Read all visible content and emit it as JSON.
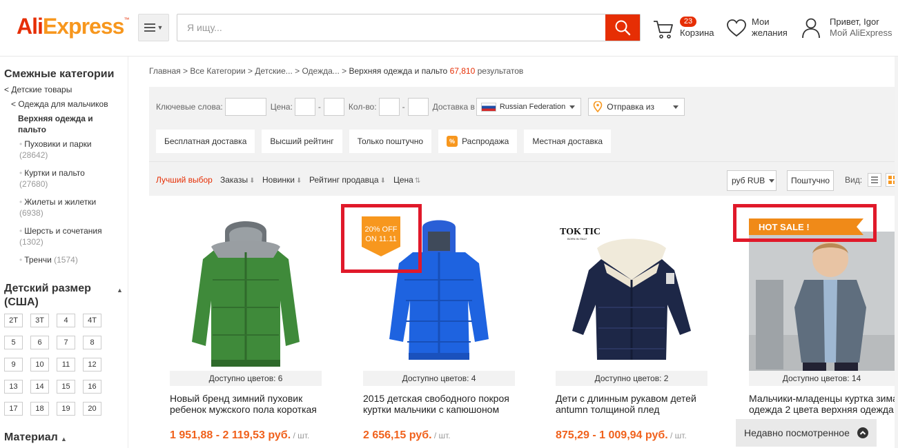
{
  "header": {
    "logo_part1": "Ali",
    "logo_part2": "Express",
    "logo_tm": "™",
    "search_placeholder": "Я ищу...",
    "cart_count": "23",
    "cart_label": "Корзина",
    "wishlist_line1": "Мои",
    "wishlist_line2": "желания",
    "account_line1": "Привет, Igor",
    "account_line2": "Мой AliExpress"
  },
  "sidebar": {
    "related_heading": "Смежные категории",
    "cat_parent": "< Детские товары",
    "cat_sub": "< Одежда для мальчиков",
    "cat_current": "Верхняя одежда и пальто",
    "subcats": [
      {
        "label": "Пуховики и парки",
        "count": "(28642)"
      },
      {
        "label": "Куртки и пальто",
        "count": "(27680)"
      },
      {
        "label": "Жилеты и жилетки",
        "count": "(6938)"
      },
      {
        "label": "Шерсть и сочетания",
        "count": "(1302)"
      },
      {
        "label": "Тренчи",
        "count": "(1574)"
      }
    ],
    "size_heading": "Детский размер (США)",
    "sizes": [
      "2T",
      "3T",
      "4",
      "4T",
      "5",
      "6",
      "7",
      "8",
      "9",
      "10",
      "11",
      "12",
      "13",
      "14",
      "15",
      "16",
      "17",
      "18",
      "19",
      "20"
    ],
    "material_heading": "Материал"
  },
  "breadcrumb": {
    "items": [
      "Главная",
      "Все Категории",
      "Детские...",
      "Одежда..."
    ],
    "current": "Верхняя одежда и пальто",
    "result_count": "67,810",
    "result_label": "результатов"
  },
  "filters": {
    "keywords_label": "Ключевые слова:",
    "price_label": "Цена:",
    "qty_label": "Кол-во:",
    "dash": "-",
    "ship_to_label": "Доставка в",
    "ship_to_value": "Russian Federation",
    "ship_from_label": "Отправка из",
    "buttons": [
      "Бесплатная доставка",
      "Высший рейтинг",
      "Только поштучно",
      "Распродажа",
      "Местная доставка"
    ],
    "sale_icon_text": "%"
  },
  "sortbar": {
    "best": "Лучший выбор",
    "orders": "Заказы",
    "newest": "Новинки",
    "seller_rating": "Рейтинг продавца",
    "price": "Цена",
    "currency": "руб RUB",
    "per_piece": "Поштучно",
    "view_label": "Вид:"
  },
  "products": [
    {
      "colors": "Доступно цветов: 6",
      "title1": "Новый бренд зимний пуховик",
      "title2": "ребенок мужского пола короткая",
      "price": "1 951,88 - 2 119,53 руб.",
      "unit": " / шт."
    },
    {
      "colors": "Доступно цветов: 4",
      "title1": "2015 детская свободного покроя",
      "title2": "куртки мальчики с капюшоном",
      "price": "2 656,15 руб.",
      "unit": " / шт.",
      "badge1": "20% OFF",
      "badge2": "ON 11.11"
    },
    {
      "colors": "Доступно цветов: 2",
      "title1": "Дети с длинным рукавом детей",
      "title2": "antumn толщиной плед",
      "price": "875,29 - 1 009,94 руб.",
      "unit": " / шт.",
      "brand1": "TOK TIC",
      "brand2": "BORN IN ITALY"
    },
    {
      "colors": "Доступно цветов: 14",
      "title1": "Мальчики-младенцы куртка зима",
      "title2": "одежда 2 цвета верхняя одежда",
      "price": "",
      "unit": "",
      "banner": "HOT SALE !"
    }
  ],
  "recently_viewed": "Недавно посмотренное",
  "colors": {
    "brand_red": "#e62e04",
    "brand_orange": "#f7971e",
    "highlight_red": "#e0192a",
    "price_orange": "#f0611c"
  }
}
